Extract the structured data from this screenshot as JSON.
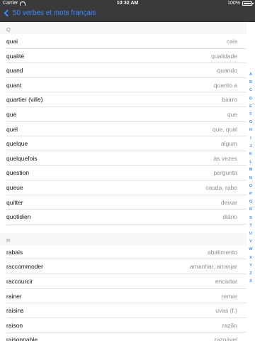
{
  "status": {
    "carrier": "Carrier",
    "time": "10:32 AM",
    "battery": "100%",
    "battery_level": 1.0
  },
  "nav": {
    "back_label": "50 verbes et mots français"
  },
  "sections": [
    {
      "letter": "Q",
      "rows": [
        {
          "fr": "quai",
          "pt": "cais"
        },
        {
          "fr": "qualité",
          "pt": "qualidade"
        },
        {
          "fr": "quand",
          "pt": "quando"
        },
        {
          "fr": "quant",
          "pt": "quanto a"
        },
        {
          "fr": "quartier (ville)",
          "pt": "bairro"
        },
        {
          "fr": "que",
          "pt": "que"
        },
        {
          "fr": "quel",
          "pt": "que, qual"
        },
        {
          "fr": "quelque",
          "pt": "algum"
        },
        {
          "fr": "quelquefois",
          "pt": "às vezes"
        },
        {
          "fr": "question",
          "pt": "pergunta"
        },
        {
          "fr": "queue",
          "pt": "cauda, rabo"
        },
        {
          "fr": "quitter",
          "pt": "deixar"
        },
        {
          "fr": "quotidien",
          "pt": "diário"
        }
      ]
    },
    {
      "letter": "R",
      "rows": [
        {
          "fr": "rabais",
          "pt": "abatimento"
        },
        {
          "fr": "raccommoder",
          "pt": "amanhar, arranjar"
        },
        {
          "fr": "raccourcir",
          "pt": "encartar"
        },
        {
          "fr": "rainer",
          "pt": "remar"
        },
        {
          "fr": "raisins",
          "pt": "uvas (f.)"
        },
        {
          "fr": "raison",
          "pt": "razão"
        },
        {
          "fr": "raisonnable",
          "pt": "razoável"
        }
      ]
    }
  ],
  "index_letters": [
    "A",
    "B",
    "C",
    "D",
    "E",
    "F",
    "G",
    "H",
    "I",
    "J",
    "K",
    "L",
    "M",
    "N",
    "O",
    "P",
    "Q",
    "R",
    "S",
    "T",
    "U",
    "V",
    "W",
    "X",
    "Y",
    "Z",
    "ß"
  ],
  "colors": {
    "accent": "#3d8cff",
    "bar": "#3a3a3c",
    "secondary_text": "#8e8e93"
  }
}
